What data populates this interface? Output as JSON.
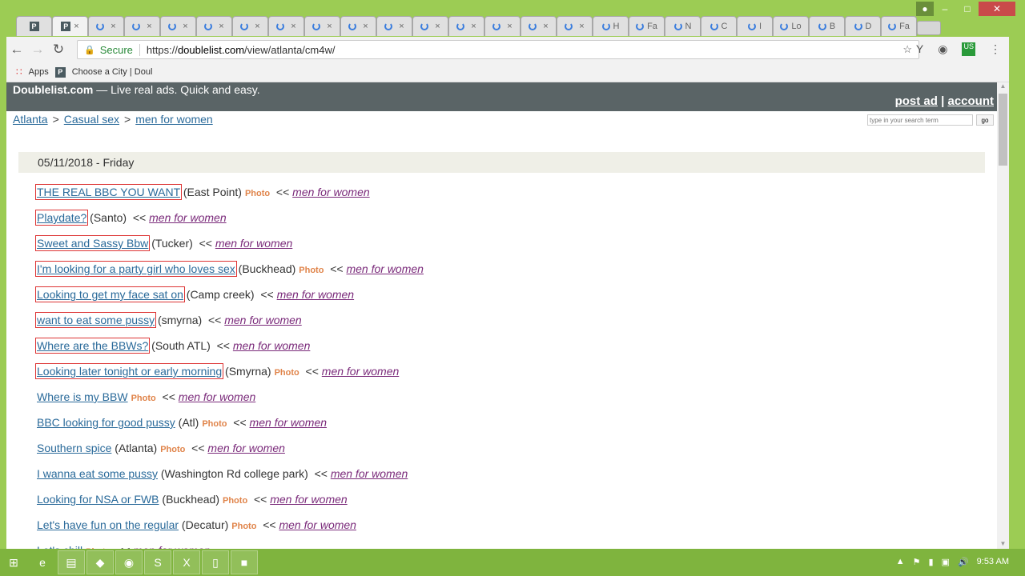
{
  "browser": {
    "tabs": [
      "P",
      "P",
      "",
      "",
      "",
      "",
      "",
      "",
      "",
      "",
      "",
      "",
      "",
      "",
      "",
      "",
      "H",
      "Fa",
      "N",
      "C",
      "I",
      "Lo",
      "B",
      "D",
      "Fa"
    ],
    "active_tab_index": 1,
    "secure_label": "Secure",
    "url_prefix": "https://",
    "url_domain": "doublelist.com",
    "url_path": "/view/atlanta/cm4w/",
    "bookmarks": {
      "apps": "Apps",
      "item": "Choose a City | Doul"
    },
    "ext_badge": "US"
  },
  "site": {
    "brand": "Doublelist.com",
    "tagline": " — Live real ads. Quick and easy.",
    "post_ad": "post ad",
    "sep": "|",
    "account": "account",
    "breadcrumb": [
      "Atlanta",
      "Casual sex",
      "men for women"
    ],
    "crumb_sep": ">",
    "search_placeholder": "type in your search term",
    "search_go": "go",
    "date_header": "05/11/2018 - Friday",
    "photo_label": "Photo",
    "arrow": "<<",
    "listings": [
      {
        "title": "THE REAL BBC YOU WANT",
        "loc": "(East Point)",
        "photo": true,
        "cat": "men for women",
        "boxed": true
      },
      {
        "title": "Playdate?",
        "loc": "(Santo)",
        "photo": false,
        "cat": "men for women",
        "boxed": true
      },
      {
        "title": "Sweet and Sassy Bbw",
        "loc": "(Tucker)",
        "photo": false,
        "cat": "men for women",
        "boxed": true
      },
      {
        "title": "I'm looking for a party girl who loves sex",
        "loc": "(Buckhead)",
        "photo": true,
        "cat": "men for women",
        "boxed": true
      },
      {
        "title": "Looking to get my face sat on",
        "loc": "(Camp creek)",
        "photo": false,
        "cat": "men for women",
        "boxed": true
      },
      {
        "title": "want to eat some pussy",
        "loc": "(smyrna)",
        "photo": false,
        "cat": "men for women",
        "boxed": true
      },
      {
        "title": "Where are the BBWs?",
        "loc": "(South ATL)",
        "photo": false,
        "cat": "men for women",
        "boxed": true
      },
      {
        "title": "Looking later tonight or early morning",
        "loc": "(Smyrna)",
        "photo": true,
        "cat": "men for women",
        "boxed": true
      },
      {
        "title": "Where is my BBW",
        "loc": "",
        "photo": true,
        "cat": "men for women",
        "boxed": false
      },
      {
        "title": "BBC looking for good pussy",
        "loc": "(Atl)",
        "photo": true,
        "cat": "men for women",
        "boxed": false
      },
      {
        "title": "Southern spice",
        "loc": "(Atlanta)",
        "photo": true,
        "cat": "men for women",
        "boxed": false
      },
      {
        "title": "I wanna eat some pussy",
        "loc": "(Washington Rd college park)",
        "photo": false,
        "cat": "men for women",
        "boxed": false
      },
      {
        "title": "Looking for NSA or FWB",
        "loc": "(Buckhead)",
        "photo": true,
        "cat": "men for women",
        "boxed": false
      },
      {
        "title": "Let's have fun on the regular",
        "loc": "(Decatur)",
        "photo": true,
        "cat": "men for women",
        "boxed": false
      },
      {
        "title": "Let's chill",
        "loc": "",
        "photo": true,
        "cat": "men for women",
        "boxed": false
      }
    ]
  },
  "taskbar": {
    "time": "9:53 AM"
  }
}
